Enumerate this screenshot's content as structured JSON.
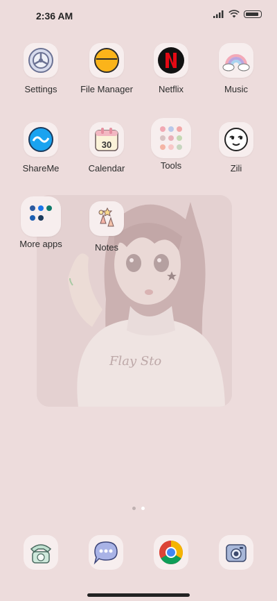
{
  "status_bar": {
    "time": "2:36 AM"
  },
  "apps": [
    {
      "label": "Settings",
      "icon": "settings-gear-icon"
    },
    {
      "label": "File Manager",
      "icon": "file-manager-icon"
    },
    {
      "label": "Netflix",
      "icon": "netflix-icon"
    },
    {
      "label": "Music",
      "icon": "music-rainbow-icon"
    },
    {
      "label": "ShareMe",
      "icon": "shareme-icon"
    },
    {
      "label": "Calendar",
      "icon": "calendar-icon",
      "day": "30"
    },
    {
      "label": "Tools",
      "icon": "tools-folder-icon"
    },
    {
      "label": "Zili",
      "icon": "zili-face-icon"
    },
    {
      "label": "More apps",
      "icon": "more-apps-folder-icon"
    },
    {
      "label": "Notes",
      "icon": "notes-icon"
    }
  ],
  "dock": [
    {
      "icon": "phone-icon"
    },
    {
      "icon": "messages-icon"
    },
    {
      "icon": "chrome-icon"
    },
    {
      "icon": "camera-icon"
    }
  ],
  "pages": {
    "count": 2,
    "active": 1
  },
  "colors": {
    "background": "#eddcdc",
    "tile": "#f7eeee",
    "netflix": "#e50914"
  }
}
